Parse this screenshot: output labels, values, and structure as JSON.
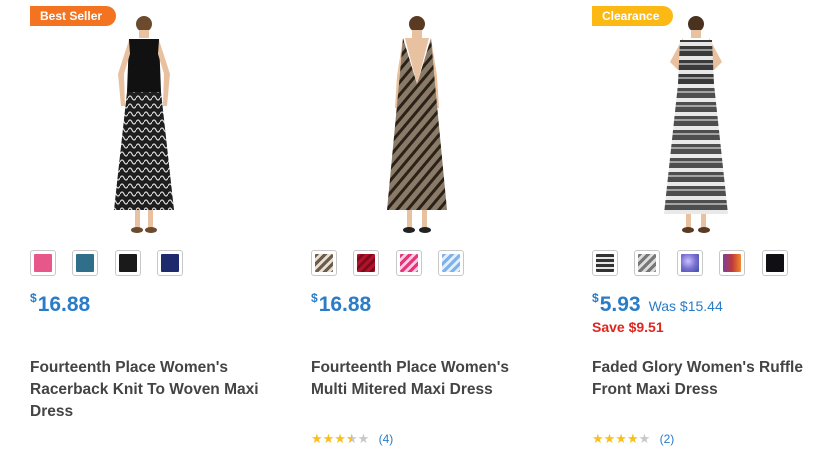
{
  "products": [
    {
      "badge": "Best Seller",
      "price_dollar": "$",
      "price_amount": "16.88",
      "title": "Fourteenth Place Women's Racerback Knit To Woven Maxi Dress",
      "swatch_colors": [
        "#e8578a",
        "#2f6f8a",
        "#1a1a1a",
        "#1d2a6b"
      ],
      "rating_text": "",
      "review_count": ""
    },
    {
      "badge": "",
      "price_dollar": "$",
      "price_amount": "16.88",
      "title": "Fourteenth Place Women's Multi Mitered Maxi Dress",
      "swatch_colors": [
        "#6b5c4e",
        "#b3122a",
        "#e8347a",
        "#7fb2ea"
      ],
      "rating": 3.5,
      "review_count": "(4)"
    },
    {
      "badge": "Clearance",
      "price_dollar": "$",
      "price_amount": "5.93",
      "was_price": "Was $15.44",
      "save_text": "Save $9.51",
      "title": "Faded Glory Women's Ruffle Front Maxi Dress",
      "swatch_colors": [
        "#333333",
        "#777777",
        "#7a6fd1",
        "#c0393a",
        "#0f0f14"
      ],
      "rating": 4,
      "review_count": "(2)"
    }
  ],
  "colors": {
    "price_blue": "#2a7cc7",
    "save_red": "#e0261e",
    "badge_orange": "#f47321",
    "badge_yellow": "#fdb913",
    "star_yellow": "#f8c01f"
  }
}
